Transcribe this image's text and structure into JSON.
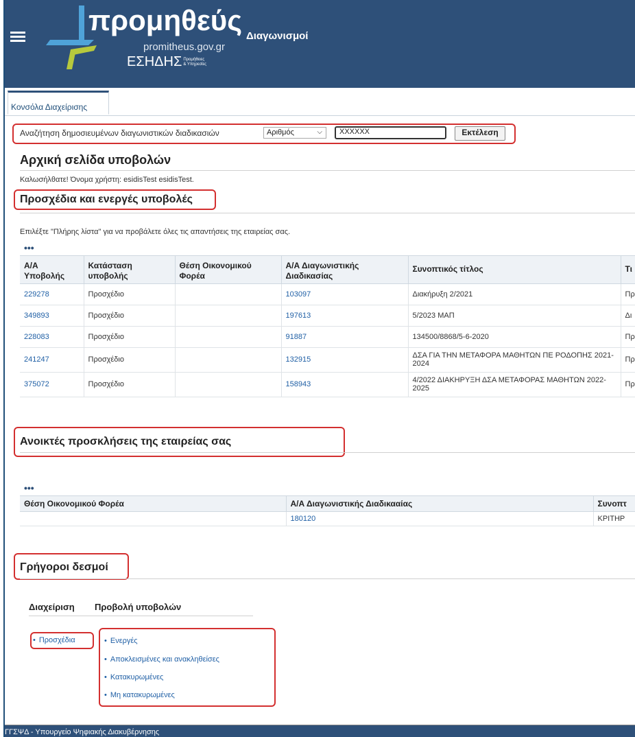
{
  "header": {
    "logo_title": "προμηθεύς",
    "logo_subtitle": "Διαγωνισμοί",
    "logo_domain": "promitheus.gov.gr",
    "logo_org": "ΕΣΗΔΗΣ",
    "logo_org_small_1": "Προμήθειες",
    "logo_org_small_2": "& Υπηρεσίες",
    "menu_icon": "hamburger-menu-icon"
  },
  "tabs": [
    {
      "label": "Κονσόλα Διαχείρισης",
      "active": true
    }
  ],
  "search": {
    "label": "Αναζήτηση δημοσιευμένων διαγωνιστικών διαδικασιών",
    "select_value": "Αριθμός",
    "input_value": "XXXXXX",
    "button_label": "Εκτέλεση"
  },
  "page": {
    "title": "Αρχική σελίδα υποβολών",
    "welcome": "Καλωσήλθατε! Όνομα χρήστη: esidisTest esidisTest."
  },
  "drafts": {
    "title": "Προσχέδια και ενεργές υποβολές",
    "hint": "Επιλέξτε \"Πλήρης λίστα\" για να προβάλετε όλες τις απαντήσεις της εταιρείας σας.",
    "dots": "•••",
    "columns": [
      "Α/Α Υποβολής",
      "Κατάσταση υποβολής",
      "Θέση Οικονομικού Φορέα",
      "Α/Α Διαγωνιστικής Διαδικασίας",
      "Συνοπτικός τίτλος",
      "Τι"
    ],
    "rows": [
      {
        "id": "229278",
        "status": "Προσχέδιο",
        "position": "",
        "proc": "103097",
        "title": "Διακήρυξη 2/2021",
        "extra": "Πρ"
      },
      {
        "id": "349893",
        "status": "Προσχέδιο",
        "position": "",
        "proc": "197613",
        "title": "5/2023 ΜΑΠ",
        "extra": "Δι"
      },
      {
        "id": "228083",
        "status": "Προσχέδιο",
        "position": "",
        "proc": "91887",
        "title": "134500/8868/5-6-2020",
        "extra": "Πρ"
      },
      {
        "id": "241247",
        "status": "Προσχέδιο",
        "position": "",
        "proc": "132915",
        "title": "ΔΣΑ ΓΙΑ ΤΗΝ ΜΕΤΑΦΟΡΑ ΜΑΘΗΤΩΝ ΠΕ ΡΟΔΟΠΗΣ 2021-2024",
        "extra": "Πρ"
      },
      {
        "id": "375072",
        "status": "Προσχέδιο",
        "position": "",
        "proc": "158943",
        "title": "4/2022 ΔΙΑΚΗΡΥΞΗ ΔΣΑ ΜΕΤΑΦΟΡΑΣ ΜΑΘΗΤΩΝ 2022-2025",
        "extra": "Πρ"
      }
    ]
  },
  "invitations": {
    "title": "Ανοικτές προσκλήσεις της εταιρείας σας",
    "dots": "•••",
    "columns": [
      "Θέση Οικονομικού Φορέα",
      "Α/Α Διαγωνιστικής Διαδικααίας",
      "Συνοπτ"
    ],
    "rows": [
      {
        "position": "",
        "proc": "180120",
        "title": "ΚΡΙΤΗΡ"
      }
    ]
  },
  "quick_links": {
    "title": "Γρήγοροι δεσμοί",
    "col1_header": "Διαχείριση",
    "col2_header": "Προβολή υποβολών",
    "col1_items": [
      "Προσχέδια"
    ],
    "col2_items": [
      "Ενεργές",
      "Αποκλεισμένες και ανακληθείσες",
      "Κατακυρωμένες",
      "Μη κατακυρωμένες"
    ]
  },
  "footer": {
    "text": "ΓΓΣΨΔ - Υπουργείο Ψηφιακής Διακυβέρνησης"
  },
  "colors": {
    "header_bg": "#2e5079",
    "link": "#1f5fa5",
    "highlight": "#d32f2f"
  }
}
